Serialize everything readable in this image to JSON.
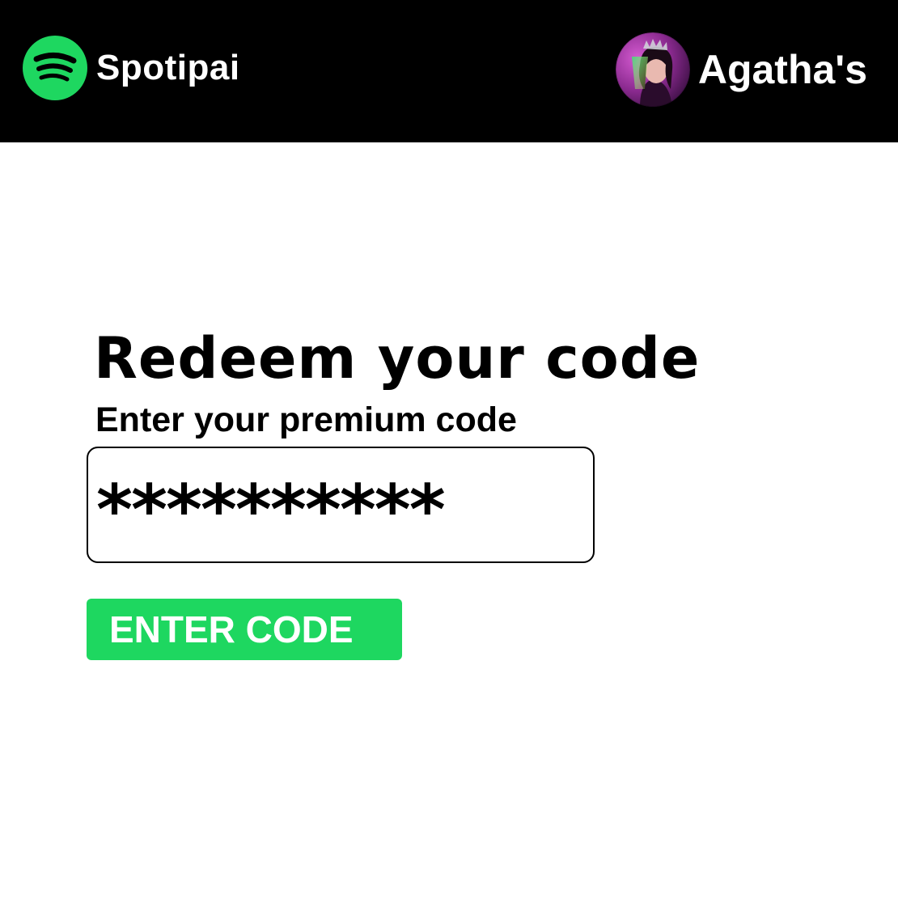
{
  "header": {
    "brand_name": "Spotipai",
    "brand_color": "#1ed760",
    "account_name": "Agatha's",
    "logo_icon": "spotify-logo-icon",
    "avatar_icon": "profile-avatar-photo"
  },
  "redeem": {
    "title": "Redeem your code",
    "subtitle": "Enter your premium code",
    "code_value": "**********",
    "button_label": "ENTER CODE",
    "button_color": "#1ed760"
  }
}
